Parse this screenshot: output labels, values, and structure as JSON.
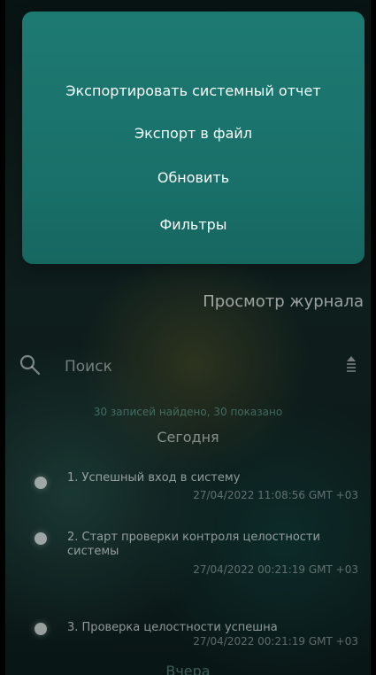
{
  "menu": {
    "items": [
      "Экспортировать системный отчет",
      "Экспорт в файл",
      "Обновить",
      "Фильтры"
    ]
  },
  "header": {
    "title": "Просмотр журнала"
  },
  "search": {
    "placeholder": "Поиск"
  },
  "results": {
    "summary": "30 записей найдено, 30 показано"
  },
  "sections": {
    "today": "Сегодня",
    "yesterday": "Вчера"
  },
  "logs": [
    {
      "text": "1. Успешный вход в систему",
      "time": "27/04/2022 11:08:56 GMT +03"
    },
    {
      "text": "2. Старт проверки контроля целостности системы",
      "time": "27/04/2022 00:21:19 GMT +03"
    },
    {
      "text": "3. Проверка целостности успешна",
      "time": "27/04/2022 00:21:19 GMT +03"
    }
  ],
  "icons": {
    "search": "search-icon",
    "sort": "sort-icon"
  },
  "colors": {
    "menu_background": "#1d7a72",
    "background_dark": "#0a1716",
    "accent_teal": "#166760"
  }
}
